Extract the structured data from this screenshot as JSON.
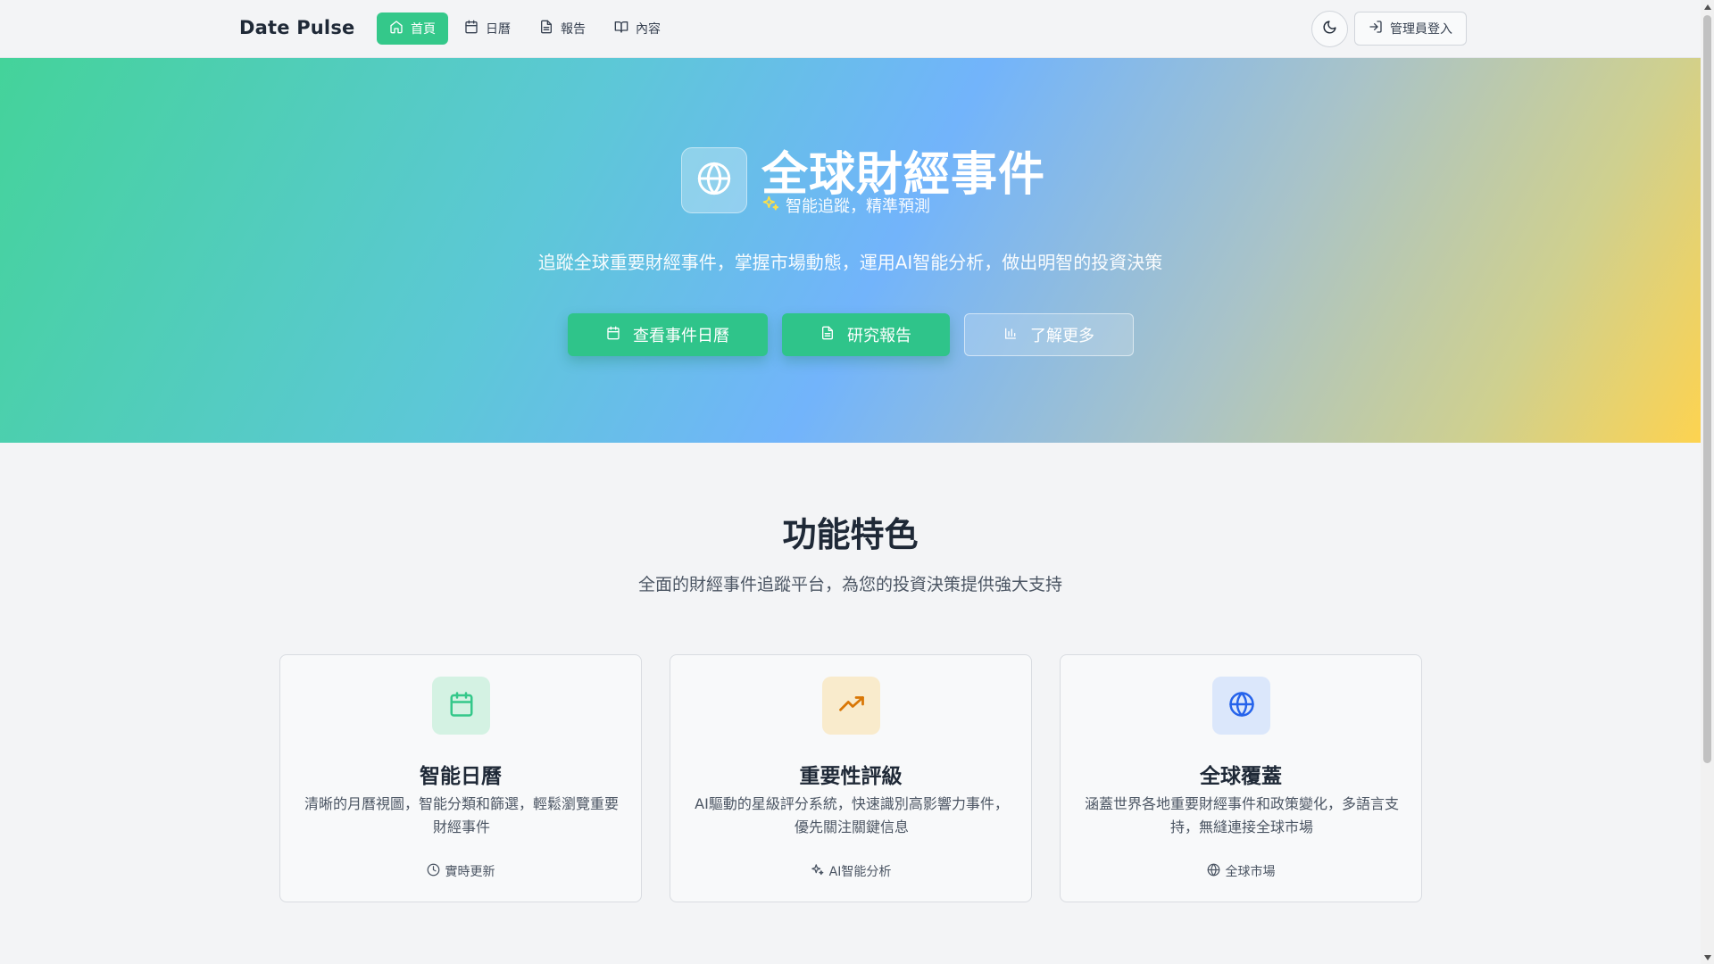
{
  "header": {
    "brand": "Date Pulse",
    "nav": [
      {
        "label": "首頁",
        "icon": "home-icon",
        "active": true
      },
      {
        "label": "日曆",
        "icon": "calendar-icon",
        "active": false
      },
      {
        "label": "報告",
        "icon": "file-text-icon",
        "active": false
      },
      {
        "label": "內容",
        "icon": "book-open-icon",
        "active": false
      }
    ],
    "theme_toggle_icon": "moon-icon",
    "login_label": "管理員登入"
  },
  "hero": {
    "title": "全球財經事件",
    "tagline": "智能追蹤，精準預測",
    "description": "追蹤全球重要財經事件，掌握市場動態，運用AI智能分析，做出明智的投資決策",
    "buttons": {
      "calendar": "查看事件日曆",
      "reports": "研究報告",
      "learn_more": "了解更多"
    }
  },
  "features": {
    "title": "功能特色",
    "subtitle": "全面的財經事件追蹤平台，為您的投資決策提供強大支持",
    "cards": [
      {
        "title": "智能日曆",
        "description": "清晰的月曆視圖，智能分類和篩選，輕鬆瀏覽重要財經事件",
        "meta": "實時更新",
        "icon": "calendar-icon",
        "icon_color": "#34c88a",
        "icon_bg": "#d4f2e3"
      },
      {
        "title": "重要性評級",
        "description": "AI驅動的星級評分系統，快速識別高影響力事件，優先關注關鍵信息",
        "meta": "AI智能分析",
        "icon": "trending-up-icon",
        "icon_color": "#d97706",
        "icon_bg": "#f9ebcc"
      },
      {
        "title": "全球覆蓋",
        "description": "涵蓋世界各地重要財經事件和政策變化，多語言支持，無縫連接全球市場",
        "meta": "全球市場",
        "icon": "globe-icon",
        "icon_color": "#2563eb",
        "icon_bg": "#dbe7fb"
      }
    ]
  },
  "colors": {
    "accent": "#34c88a",
    "hero_gradient_start": "#44d39a",
    "hero_gradient_mid": "#72b4fb",
    "hero_gradient_end": "#fdd350"
  }
}
